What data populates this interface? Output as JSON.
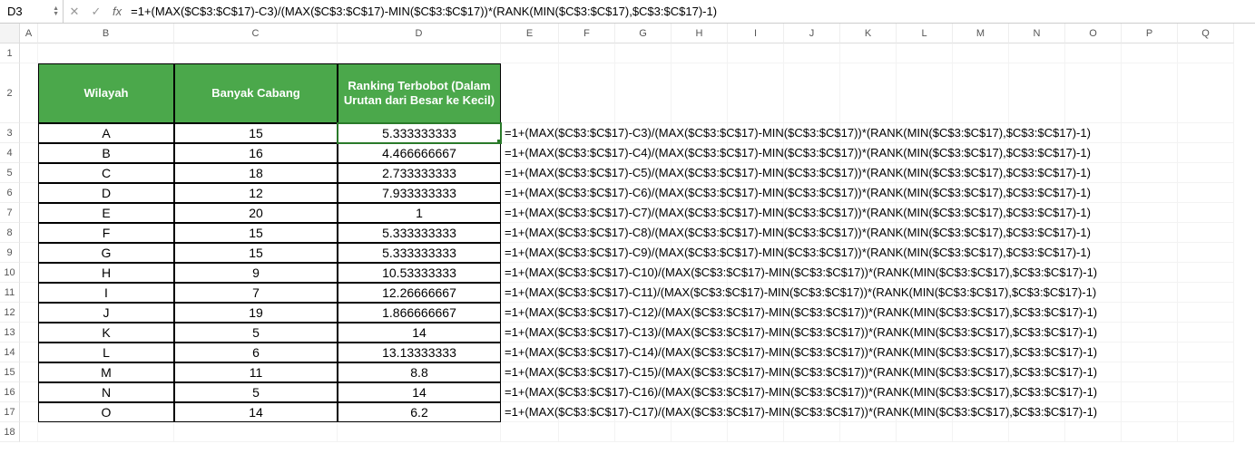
{
  "nameBox": "D3",
  "formulaBar": "=1+(MAX($C$3:$C$17)-C3)/(MAX($C$3:$C$17)-MIN($C$3:$C$17))*(RANK(MIN($C$3:$C$17),$C$3:$C$17)-1)",
  "columns": [
    "A",
    "B",
    "C",
    "D",
    "E",
    "F",
    "G",
    "H",
    "I",
    "J",
    "K",
    "L",
    "M",
    "N",
    "O",
    "P",
    "Q"
  ],
  "headers": {
    "B": "Wilayah",
    "C": "Banyak Cabang",
    "D": "Ranking Terbobot (Dalam Urutan dari Besar ke Kecil)"
  },
  "rows": [
    {
      "wilayah": "A",
      "cabang": "15",
      "rank": "5.333333333",
      "formula": "=1+(MAX($C$3:$C$17)-C3)/(MAX($C$3:$C$17)-MIN($C$3:$C$17))*(RANK(MIN($C$3:$C$17),$C$3:$C$17)-1)"
    },
    {
      "wilayah": "B",
      "cabang": "16",
      "rank": "4.466666667",
      "formula": "=1+(MAX($C$3:$C$17)-C4)/(MAX($C$3:$C$17)-MIN($C$3:$C$17))*(RANK(MIN($C$3:$C$17),$C$3:$C$17)-1)"
    },
    {
      "wilayah": "C",
      "cabang": "18",
      "rank": "2.733333333",
      "formula": "=1+(MAX($C$3:$C$17)-C5)/(MAX($C$3:$C$17)-MIN($C$3:$C$17))*(RANK(MIN($C$3:$C$17),$C$3:$C$17)-1)"
    },
    {
      "wilayah": "D",
      "cabang": "12",
      "rank": "7.933333333",
      "formula": "=1+(MAX($C$3:$C$17)-C6)/(MAX($C$3:$C$17)-MIN($C$3:$C$17))*(RANK(MIN($C$3:$C$17),$C$3:$C$17)-1)"
    },
    {
      "wilayah": "E",
      "cabang": "20",
      "rank": "1",
      "formula": "=1+(MAX($C$3:$C$17)-C7)/(MAX($C$3:$C$17)-MIN($C$3:$C$17))*(RANK(MIN($C$3:$C$17),$C$3:$C$17)-1)"
    },
    {
      "wilayah": "F",
      "cabang": "15",
      "rank": "5.333333333",
      "formula": "=1+(MAX($C$3:$C$17)-C8)/(MAX($C$3:$C$17)-MIN($C$3:$C$17))*(RANK(MIN($C$3:$C$17),$C$3:$C$17)-1)"
    },
    {
      "wilayah": "G",
      "cabang": "15",
      "rank": "5.333333333",
      "formula": "=1+(MAX($C$3:$C$17)-C9)/(MAX($C$3:$C$17)-MIN($C$3:$C$17))*(RANK(MIN($C$3:$C$17),$C$3:$C$17)-1)"
    },
    {
      "wilayah": "H",
      "cabang": "9",
      "rank": "10.53333333",
      "formula": "=1+(MAX($C$3:$C$17)-C10)/(MAX($C$3:$C$17)-MIN($C$3:$C$17))*(RANK(MIN($C$3:$C$17),$C$3:$C$17)-1)"
    },
    {
      "wilayah": "I",
      "cabang": "7",
      "rank": "12.26666667",
      "formula": "=1+(MAX($C$3:$C$17)-C11)/(MAX($C$3:$C$17)-MIN($C$3:$C$17))*(RANK(MIN($C$3:$C$17),$C$3:$C$17)-1)"
    },
    {
      "wilayah": "J",
      "cabang": "19",
      "rank": "1.866666667",
      "formula": "=1+(MAX($C$3:$C$17)-C12)/(MAX($C$3:$C$17)-MIN($C$3:$C$17))*(RANK(MIN($C$3:$C$17),$C$3:$C$17)-1)"
    },
    {
      "wilayah": "K",
      "cabang": "5",
      "rank": "14",
      "formula": "=1+(MAX($C$3:$C$17)-C13)/(MAX($C$3:$C$17)-MIN($C$3:$C$17))*(RANK(MIN($C$3:$C$17),$C$3:$C$17)-1)"
    },
    {
      "wilayah": "L",
      "cabang": "6",
      "rank": "13.13333333",
      "formula": "=1+(MAX($C$3:$C$17)-C14)/(MAX($C$3:$C$17)-MIN($C$3:$C$17))*(RANK(MIN($C$3:$C$17),$C$3:$C$17)-1)"
    },
    {
      "wilayah": "M",
      "cabang": "11",
      "rank": "8.8",
      "formula": "=1+(MAX($C$3:$C$17)-C15)/(MAX($C$3:$C$17)-MIN($C$3:$C$17))*(RANK(MIN($C$3:$C$17),$C$3:$C$17)-1)"
    },
    {
      "wilayah": "N",
      "cabang": "5",
      "rank": "14",
      "formula": "=1+(MAX($C$3:$C$17)-C16)/(MAX($C$3:$C$17)-MIN($C$3:$C$17))*(RANK(MIN($C$3:$C$17),$C$3:$C$17)-1)"
    },
    {
      "wilayah": "O",
      "cabang": "14",
      "rank": "6.2",
      "formula": "=1+(MAX($C$3:$C$17)-C17)/(MAX($C$3:$C$17)-MIN($C$3:$C$17))*(RANK(MIN($C$3:$C$17),$C$3:$C$17)-1)"
    }
  ],
  "fxLabel": "fx"
}
